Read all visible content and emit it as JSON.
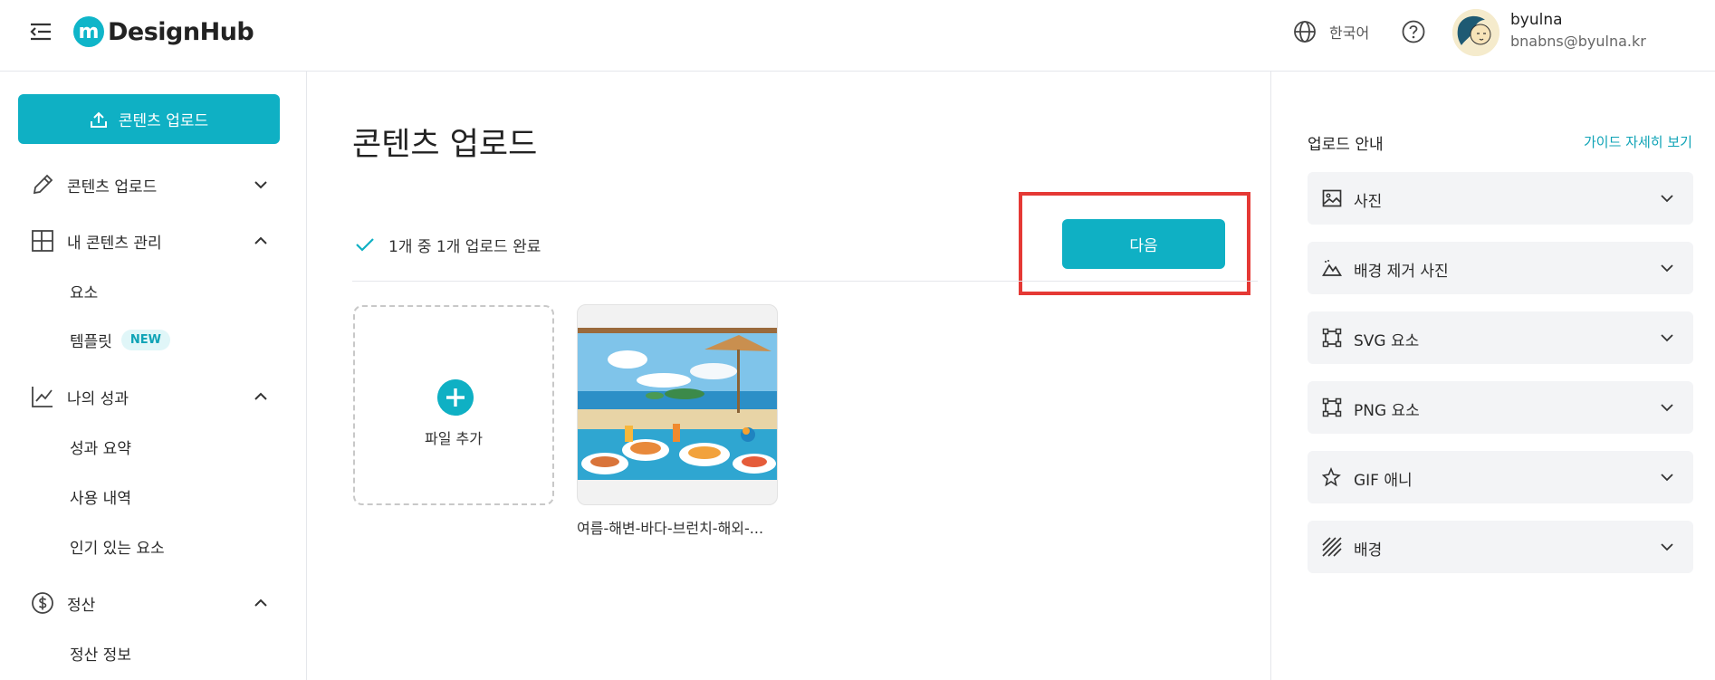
{
  "header": {
    "brand": "DesignHub",
    "brand_mark": "m",
    "language": "한국어",
    "user": {
      "name": "byulna",
      "email": "bnabns@byulna.kr"
    }
  },
  "sidebar": {
    "upload_button": "콘텐츠 업로드",
    "sections": [
      {
        "label": "콘텐츠 업로드",
        "icon": "pencil-icon",
        "expanded": false
      },
      {
        "label": "내 콘텐츠 관리",
        "icon": "layout-icon",
        "expanded": true,
        "items": [
          {
            "label": "요소"
          },
          {
            "label": "템플릿",
            "badge": "NEW"
          }
        ]
      },
      {
        "label": "나의 성과",
        "icon": "chart-icon",
        "expanded": true,
        "items": [
          {
            "label": "성과 요약"
          },
          {
            "label": "사용 내역"
          },
          {
            "label": "인기 있는 요소"
          }
        ]
      },
      {
        "label": "정산",
        "icon": "dollar-icon",
        "expanded": true,
        "items": [
          {
            "label": "정산 정보"
          }
        ]
      }
    ]
  },
  "main": {
    "title": "콘텐츠 업로드",
    "status": "1개 중 1개 업로드 완료",
    "next_button": "다음",
    "add_file": "파일 추가",
    "files": [
      {
        "name": "여름-해변-바다-브런치-해외-..."
      }
    ]
  },
  "guide": {
    "title": "업로드 안내",
    "link": "가이드 자세히 보기",
    "items": [
      {
        "label": "사진",
        "icon": "image-icon"
      },
      {
        "label": "배경 제거 사진",
        "icon": "mountain-icon"
      },
      {
        "label": "SVG 요소",
        "icon": "vector-icon"
      },
      {
        "label": "PNG 요소",
        "icon": "vector-icon"
      },
      {
        "label": "GIF 애니",
        "icon": "sparkle-icon"
      },
      {
        "label": "배경",
        "icon": "stripes-icon"
      }
    ]
  },
  "colors": {
    "accent": "#0fb0c4",
    "highlight": "#e53935",
    "badge_bg": "#e0f6f8"
  }
}
